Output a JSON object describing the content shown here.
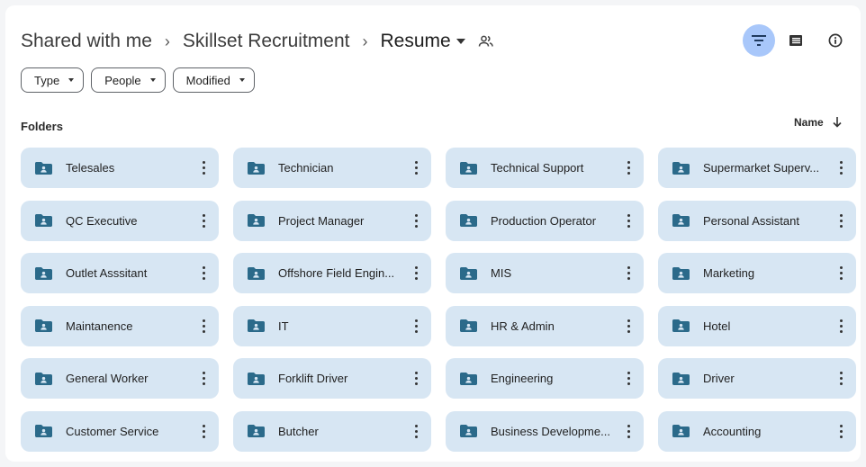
{
  "breadcrumb": {
    "items": [
      "Shared with me",
      "Skillset Recruitment",
      "Resume"
    ],
    "separator": "›"
  },
  "toolbar": {
    "filter_icon": "filter-icon",
    "list_icon": "list-view-icon",
    "info_icon": "info-icon"
  },
  "filters": {
    "chips": [
      "Type",
      "People",
      "Modified"
    ]
  },
  "section": {
    "label": "Folders"
  },
  "sort": {
    "label": "Name",
    "icon": "arrow-down-icon"
  },
  "folders": [
    "Telesales",
    "Technician",
    "Technical Support",
    "Supermarket Superv...",
    "QC Executive",
    "Project Manager",
    "Production Operator",
    "Personal Assistant",
    "Outlet Asssitant",
    "Offshore Field Engin...",
    "MIS",
    "Marketing",
    "Maintanence",
    "IT",
    "HR & Admin",
    "Hotel",
    "General Worker",
    "Forklift Driver",
    "Engineering",
    "Driver",
    "Customer Service",
    "Butcher",
    "Business Developme...",
    "Accounting"
  ],
  "colors": {
    "card_bg": "#d7e6f3",
    "filter_active": "#a8c7fa",
    "folder_icon": "#2b6a8a"
  }
}
